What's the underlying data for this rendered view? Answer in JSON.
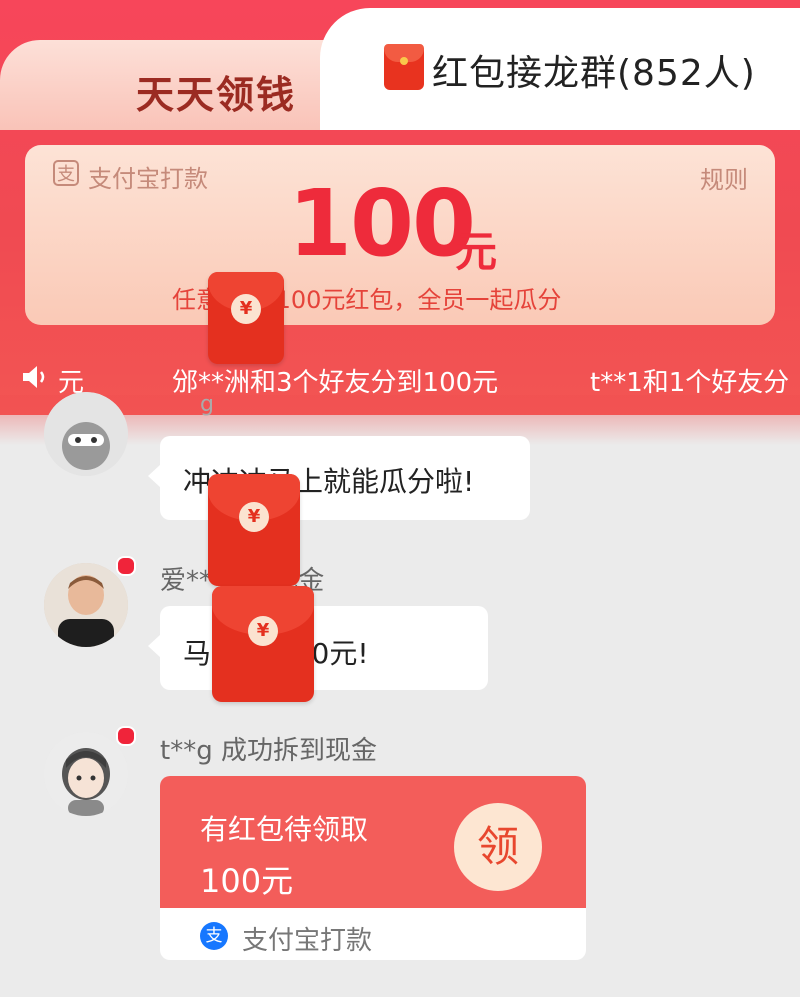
{
  "tabs": {
    "left_label": "天天领钱",
    "right_label": "红包接龙群(852人)"
  },
  "card": {
    "alipay_label": "支付宝打款",
    "alipay_glyph": "支",
    "rules_label": "规则",
    "amount": "100",
    "unit": "元",
    "description": "任意        拆到100元红包，全员一起瓜分"
  },
  "ticker": {
    "item_a": "元",
    "item_b": "邠**洲和3个好友分到100元",
    "item_c": "t**1和1个好友分"
  },
  "messages": [
    {
      "name": "g",
      "text": "冲冲冲马上就能瓜分啦!"
    },
    {
      "name": "爱**       拆到现金",
      "text": "马        拆到100元!"
    },
    {
      "name": "t**g 成功拆到现金"
    }
  ],
  "hongbao_card": {
    "title": "有红包待领取",
    "amount": "100元",
    "button_label": "领",
    "alipay_glyph": "支",
    "footer_label": "支付宝打款"
  },
  "packet_glyph": "¥",
  "colors": {
    "header_red": "#f04a52",
    "accent_red": "#ee2b3b",
    "packet_red": "#e4301f",
    "card_red": "#f35d5a"
  },
  "icons": {
    "speaker": "speaker-icon",
    "alipay": "alipay-icon",
    "red_packet": "red-packet-icon"
  }
}
